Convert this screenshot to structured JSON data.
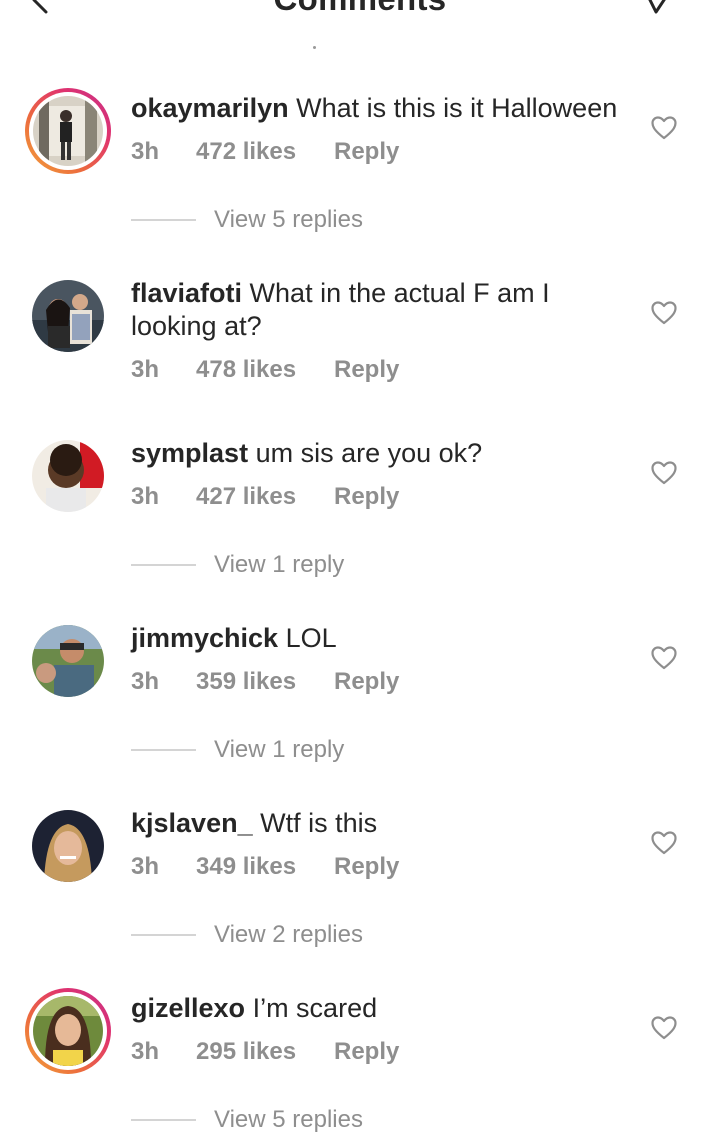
{
  "header": {
    "title": "Comments"
  },
  "comments": [
    {
      "username": "okaymarilyn",
      "text": "What is this is it Halloween",
      "time": "3h",
      "likes": "472 likes",
      "reply": "Reply",
      "view_replies": "View 5 replies"
    },
    {
      "username": "flaviafoti",
      "text": "What in the actual F am I looking at?",
      "time": "3h",
      "likes": "478 likes",
      "reply": "Reply"
    },
    {
      "username": "symplast",
      "text": "um sis are you ok?",
      "time": "3h",
      "likes": "427 likes",
      "reply": "Reply",
      "view_replies": "View 1 reply"
    },
    {
      "username": "jimmychick",
      "text": "LOL",
      "time": "3h",
      "likes": "359 likes",
      "reply": "Reply",
      "view_replies": "View 1 reply"
    },
    {
      "username": "kjslaven_",
      "text": "Wtf is this",
      "time": "3h",
      "likes": "349 likes",
      "reply": "Reply",
      "view_replies": "View 2 replies"
    },
    {
      "username": "gizellexo",
      "text": "I’m scared",
      "time": "3h",
      "likes": "295 likes",
      "reply": "Reply",
      "view_replies": "View 5 replies"
    }
  ]
}
